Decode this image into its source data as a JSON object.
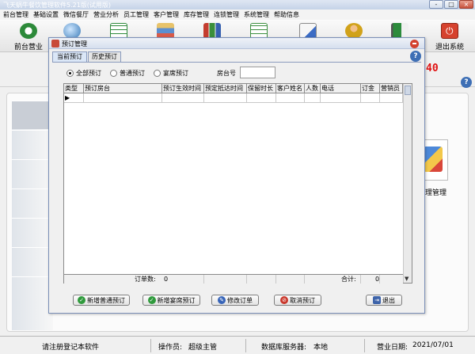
{
  "app": {
    "title": "飞天蜗牛餐饮管理软件5.21版(试用版)",
    "window_buttons": [
      "-",
      "□",
      "×"
    ]
  },
  "menubar": [
    "前台管理",
    "基础设置",
    "微信餐厅",
    "营业分析",
    "员工管理",
    "客户管理",
    "库存管理",
    "连锁管理",
    "系统管理",
    "帮助信息"
  ],
  "toolbar": [
    {
      "label": "前台营业",
      "icon": "money-icon"
    },
    {
      "label": "",
      "icon": "globe-icon"
    },
    {
      "label": "",
      "icon": "spreadsheet-icon"
    },
    {
      "label": "",
      "icon": "books-icon"
    },
    {
      "label": "",
      "icon": "stock-icon"
    },
    {
      "label": "",
      "icon": "list-icon"
    },
    {
      "label": "",
      "icon": "document-icon"
    },
    {
      "label": "",
      "icon": "users-icon"
    },
    {
      "label": "",
      "icon": "flag-icon"
    },
    {
      "label": "退出系统",
      "icon": "power-icon"
    }
  ],
  "background": {
    "red_number": "40",
    "management_label": "理管理"
  },
  "dialog": {
    "title": "预订管理",
    "tabs": [
      "当前预订",
      "历史预订"
    ],
    "filters": {
      "options": [
        "全部预订",
        "普通预订",
        "宴席预订"
      ],
      "selected": "全部预订",
      "room_label": "房台号",
      "room_value": ""
    },
    "grid": {
      "columns": [
        "类型",
        "预订房台",
        "预订生效时间",
        "预定抵达时间",
        "保留时长",
        "客户姓名",
        "人数",
        "电话",
        "订金",
        "营销员"
      ],
      "rows": [],
      "row_indicator": "▶"
    },
    "footer": {
      "order_count_label": "订单数:",
      "order_count": "0",
      "total_label": "合计:",
      "total": "0"
    },
    "buttons": [
      {
        "label": "新增普通预订",
        "icon": "check-icon"
      },
      {
        "label": "新增宴席预订",
        "icon": "check-icon"
      },
      {
        "label": "修改订单",
        "icon": "edit-icon"
      },
      {
        "label": "取消预订",
        "icon": "cancel-icon"
      },
      {
        "label": "退出",
        "icon": "exit-icon"
      }
    ]
  },
  "statusbar": {
    "register": "请注册登记本软件",
    "operator_label": "操作员:",
    "operator": "超级主管",
    "db_label": "数据库服务器:",
    "db": "本地",
    "date_label": "营业日期:",
    "date": "2021/07/01"
  },
  "colors": {
    "accent_red": "#e01010",
    "title_blue": "#3e6fb5"
  }
}
